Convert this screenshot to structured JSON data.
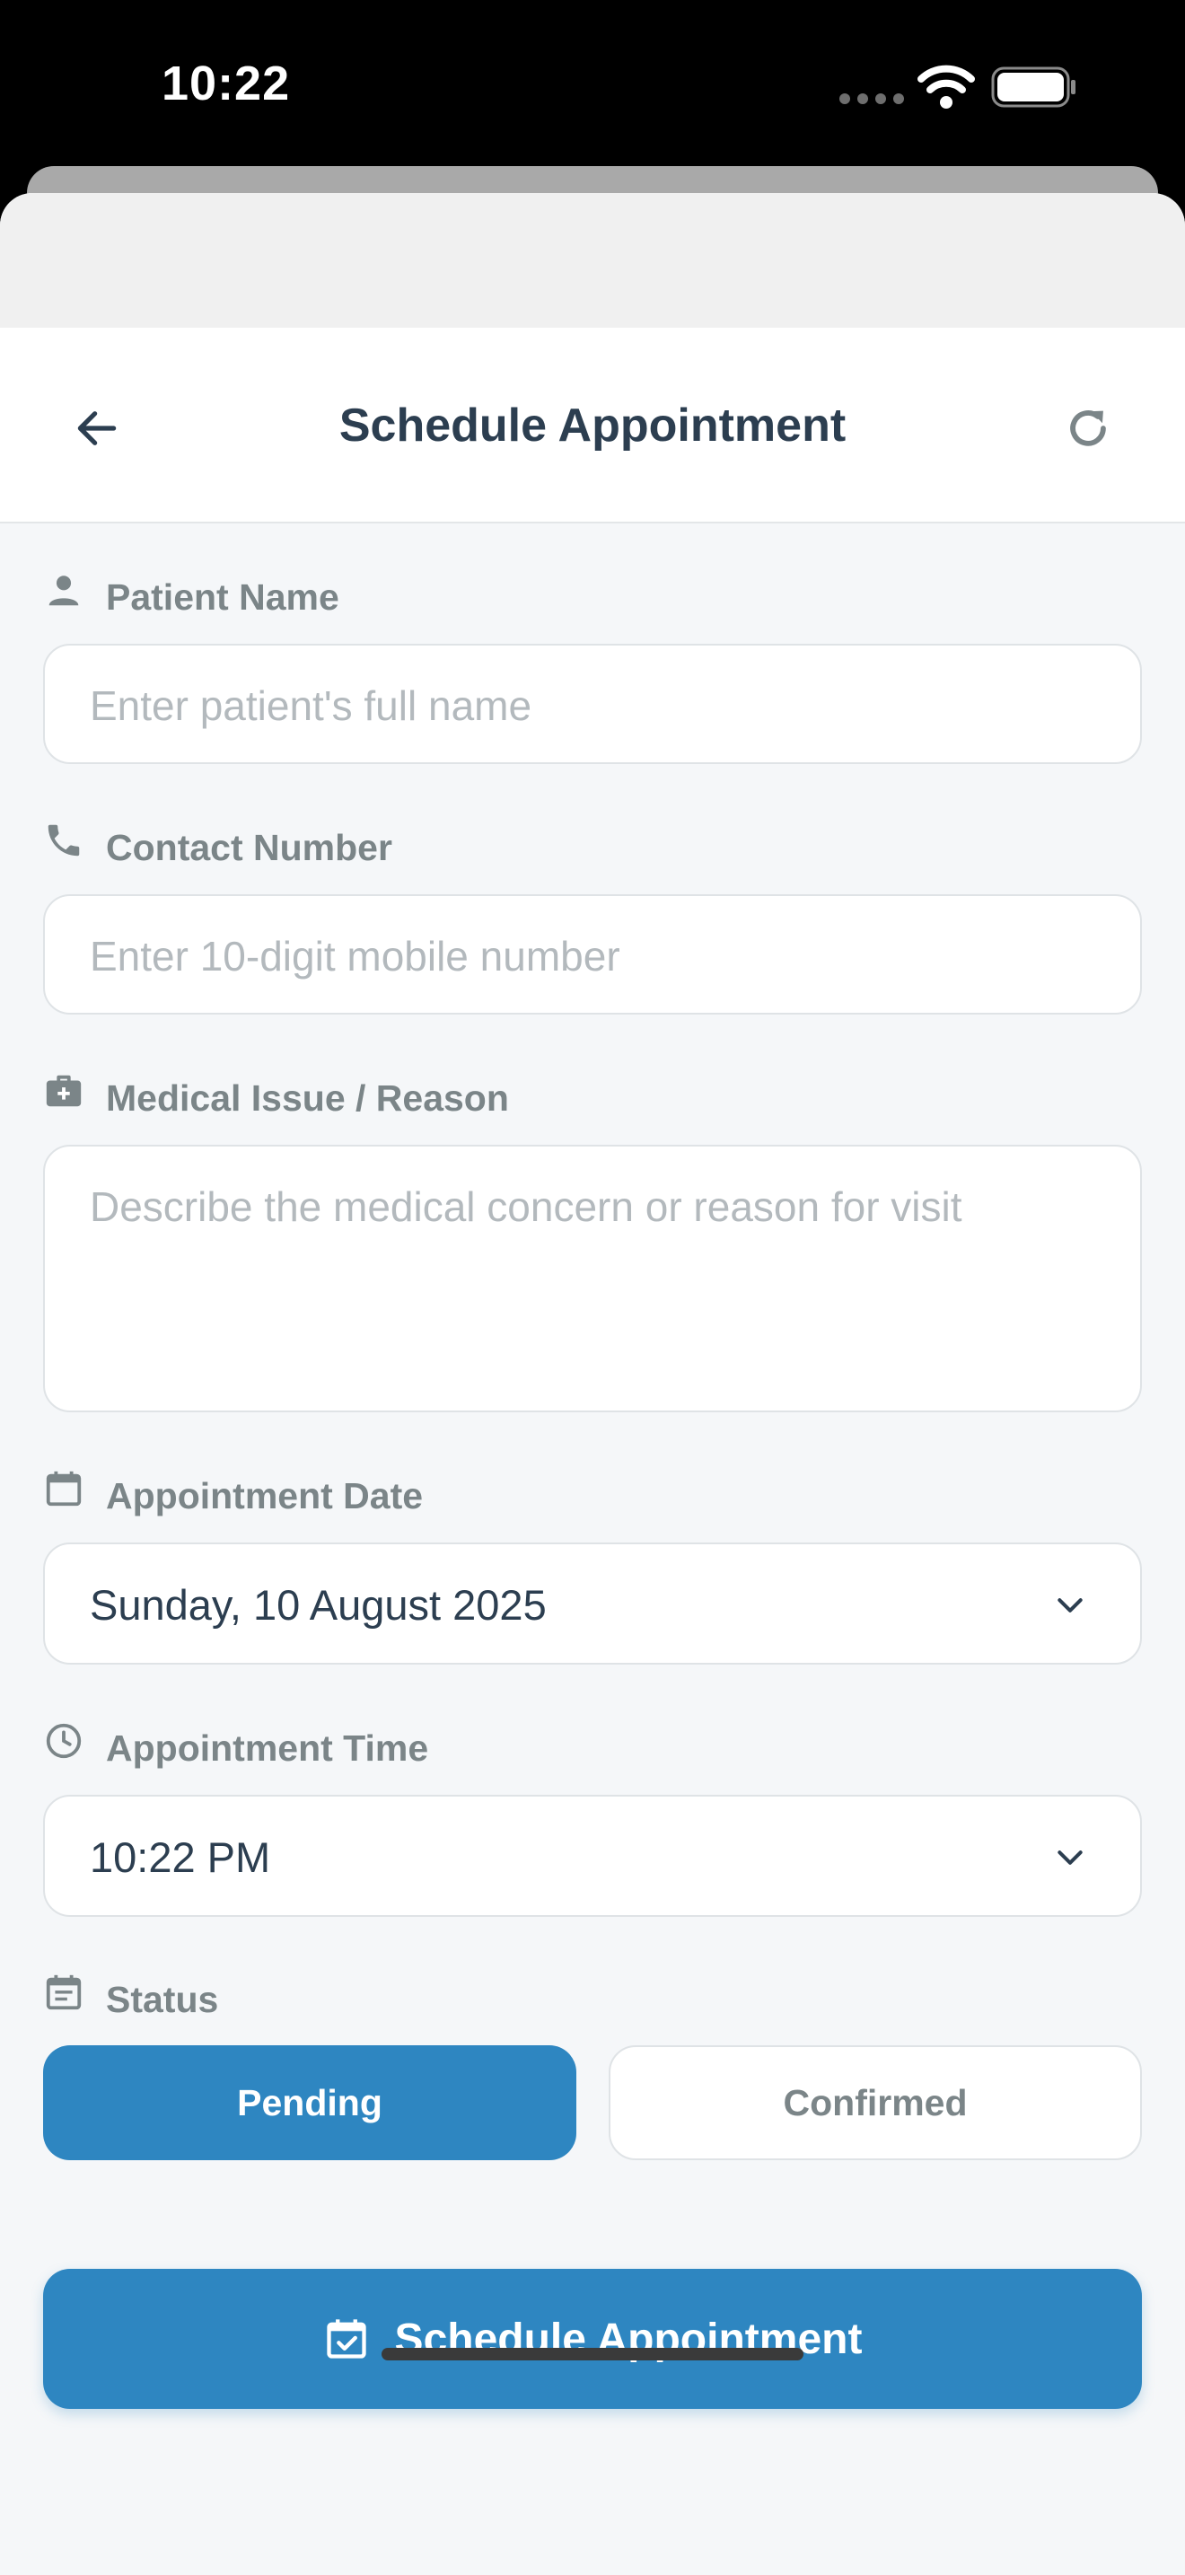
{
  "status_bar": {
    "time": "10:22"
  },
  "header": {
    "title": "Schedule Appointment",
    "back_icon": "arrow-left-icon",
    "refresh_icon": "refresh-icon"
  },
  "form": {
    "patient_name": {
      "label": "Patient Name",
      "placeholder": "Enter patient's full name",
      "icon": "person-icon"
    },
    "contact_number": {
      "label": "Contact Number",
      "placeholder": "Enter 10-digit mobile number",
      "icon": "phone-icon"
    },
    "medical_issue": {
      "label": "Medical Issue / Reason",
      "placeholder": "Describe the medical concern or reason for visit",
      "icon": "medical-bag-icon"
    },
    "appointment_date": {
      "label": "Appointment Date",
      "value": "Sunday, 10 August 2025",
      "icon": "calendar-icon"
    },
    "appointment_time": {
      "label": "Appointment Time",
      "value": "10:22 PM",
      "icon": "clock-icon"
    },
    "status": {
      "label": "Status",
      "icon": "event-note-icon",
      "options": [
        "Pending",
        "Confirmed"
      ],
      "selected": "Pending"
    }
  },
  "submit": {
    "label": "Schedule Appointment",
    "icon": "calendar-check-icon"
  },
  "colors": {
    "primary": "#2e86c1",
    "title_text": "#2c3e50",
    "label_text": "#7b8588",
    "placeholder_text": "#b3b9bd",
    "background": "#f5f7f9",
    "border": "#dfe3e6"
  }
}
